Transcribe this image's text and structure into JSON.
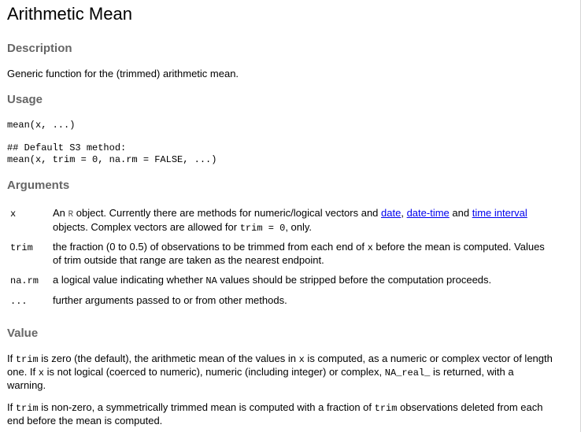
{
  "title": "Arithmetic Mean",
  "description": {
    "heading": "Description",
    "text": "Generic function for the (trimmed) arithmetic mean."
  },
  "usage": {
    "heading": "Usage",
    "line1": "mean(x, ...)",
    "comment": "## Default S3 method:",
    "line2": "mean(x, trim = 0, na.rm = FALSE, ...)"
  },
  "arguments": {
    "heading": "Arguments",
    "x": {
      "name": "x",
      "t1": "An ",
      "r": "R",
      "t2": " object. Currently there are methods for numeric/logical vectors and ",
      "link_date": "date",
      "sep": ", ",
      "link_datetime": "date-time",
      "and": " and ",
      "link_interval": "time interval",
      "t3": "objects. Complex vectors are allowed for ",
      "code": "trim = 0",
      "t4": ", only."
    },
    "trim": {
      "name": "trim",
      "t1": "the fraction (0 to 0.5) of observations to be trimmed from each end of ",
      "code": "x",
      "t2": " before the mean is computed. Values",
      "t3": "of trim outside that range are taken as the nearest endpoint."
    },
    "narm": {
      "name": "na.rm",
      "t1": "a logical value indicating whether ",
      "code": "NA",
      "t2": " values should be stripped before the computation proceeds."
    },
    "dots": {
      "name": "...",
      "text": "further arguments passed to or from other methods."
    }
  },
  "value": {
    "heading": "Value",
    "p1": {
      "a": "If ",
      "code1": "trim",
      "b": " is zero (the default), the arithmetic mean of the values in ",
      "code2": "x",
      "c": " is computed, as a numeric or complex vector of length",
      "d": "one. If ",
      "code3": "x",
      "e": " is not logical (coerced to numeric), numeric (including integer) or complex, ",
      "code4": "NA_real_",
      "f": " is returned, with a",
      "g": "warning."
    },
    "p2": {
      "a": "If ",
      "code1": "trim",
      "b": " is non-zero, a symmetrically trimmed mean is computed with a fraction of ",
      "code2": "trim",
      "c": " observations deleted from each",
      "d": "end before the mean is computed."
    }
  }
}
